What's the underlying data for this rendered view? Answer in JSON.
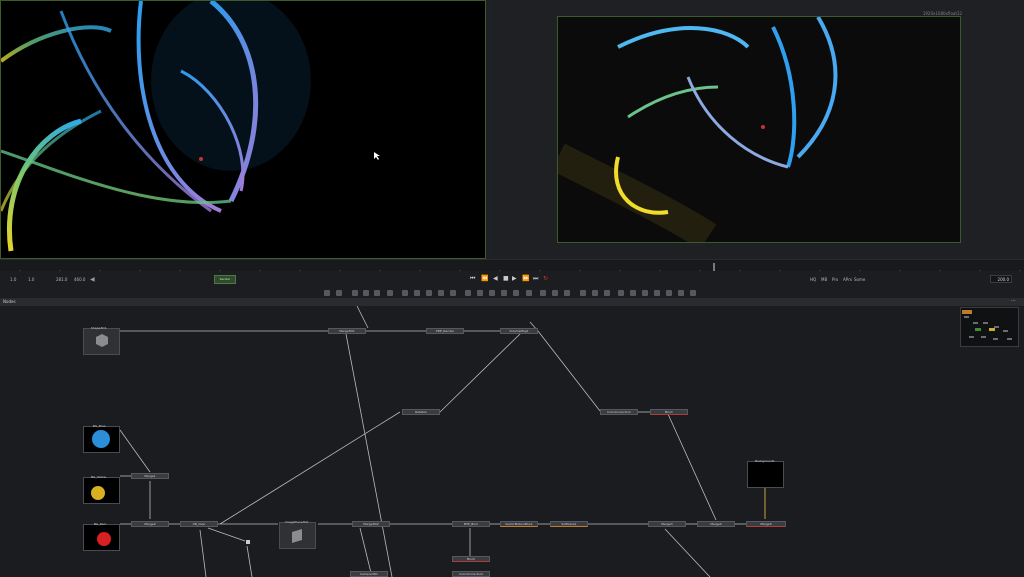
{
  "viewer": {
    "right_resolution": "1920x1080xfloat32"
  },
  "transport": {
    "field1": "1.0",
    "field2": "1.0",
    "start": "281.0",
    "end": "460.0",
    "render_btn": "Render",
    "quality_hq": "HQ",
    "quality_mb": "MB",
    "quality_prx": "Prx",
    "quality_aprx": "APrx",
    "quality_some": "Some",
    "current_frame": "200.0"
  },
  "nodes_panel": {
    "title": "Nodes",
    "nodes": {
      "shape3d": "Shape3D1",
      "merge3d": "Merge3D1",
      "pixel_render": "PDE_Render",
      "volume_mag": "VolumeMag1",
      "rotate": "Rotate1",
      "color_corrector": "ColorCorrector1",
      "blur1": "Blur1",
      "bg_blue": "BG_Blue",
      "bg_yellow": "BG_Yellow",
      "bg_red": "BG_Red",
      "merge1": "Merge1",
      "merge2": "Merge2",
      "cb_over": "CB_Over",
      "image_plane": "ImagePlane3D1",
      "merge3d2": "Merge3D2",
      "pde_burn": "PDE_Burn",
      "vector_motion_blur": "VectorMotionBlur1",
      "soft_glow": "SoftGlow1",
      "merge3": "Merge3",
      "merge4": "Merge4",
      "merge5": "Merge5",
      "background": "Background1",
      "blur2": "Blur2",
      "camera3d": "Camera3D1",
      "color_corrector2": "ColorCorrector2"
    }
  },
  "colors": {
    "accent_border": "#3c5a2a",
    "orange": "#c07a2c",
    "red_marker": "#d23a2a"
  }
}
